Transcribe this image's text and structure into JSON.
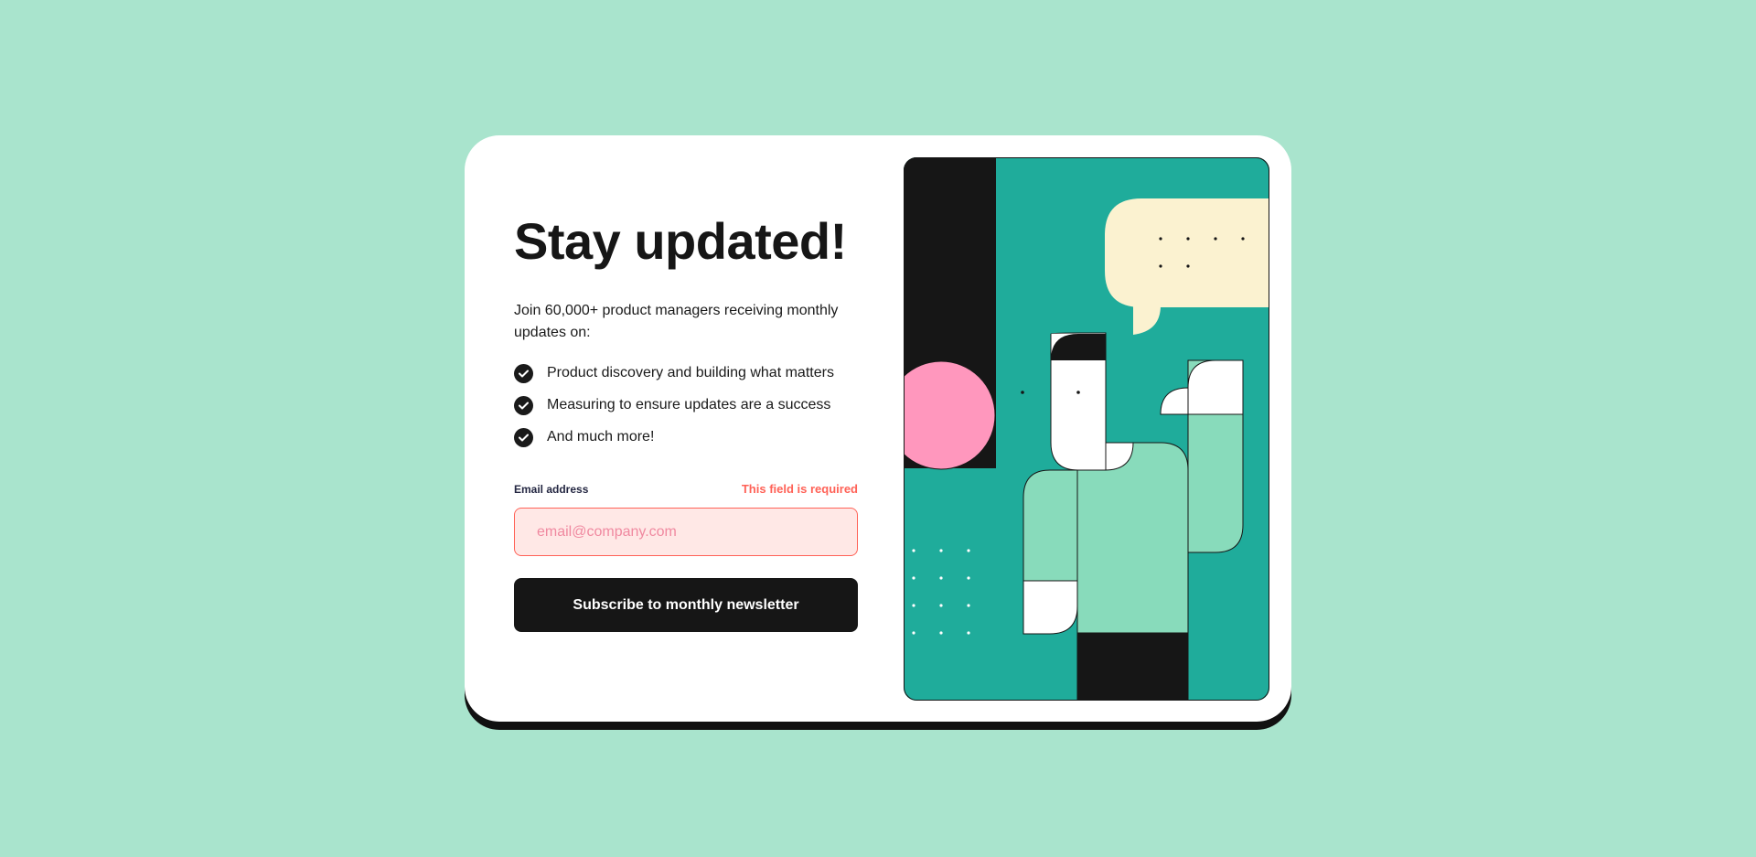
{
  "signup": {
    "title": "Stay updated!",
    "intro": "Join 60,000+ product managers receiving monthly updates on:",
    "features": [
      "Product discovery and building what matters",
      "Measuring to ensure updates are a success",
      "And much more!"
    ],
    "email": {
      "label": "Email address",
      "error": "This field is required",
      "placeholder": "email@company.com",
      "value": ""
    },
    "subscribe_label": "Subscribe to monthly newsletter"
  },
  "colors": {
    "page_background": "#a9e4cd",
    "card": "#ffffff",
    "dark": "#161616",
    "error": "#ff6257",
    "error_bg": "#ffe8e6",
    "teal": "#1fac9b",
    "mint": "#88dbbb",
    "pink": "#ff97bd",
    "cream": "#fbf2d0"
  },
  "icons": {
    "feature": "check-circle-icon"
  }
}
